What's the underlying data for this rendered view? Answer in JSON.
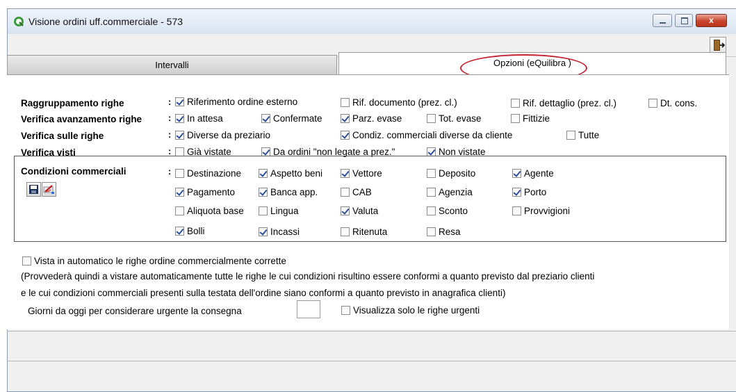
{
  "window": {
    "title": "Visione ordini uff.commerciale - 573",
    "close_label": "x"
  },
  "icons": {
    "app": "app-logo-icon",
    "exit": "exit-door-icon",
    "save": "save-disk-icon",
    "edit": "edit-pencil-icon"
  },
  "tabs": {
    "intervalli": "Intervalli",
    "opzioni": "Opzioni (eQuilibra )"
  },
  "labels": {
    "raggruppamento": "Raggruppamento righe",
    "avanzamento": "Verifica avanzamento righe",
    "sulle_righe": "Verifica sulle righe",
    "visti": "Verifica visti",
    "condizioni": "Condizioni commerciali",
    "colon": ":"
  },
  "raggruppamento": [
    {
      "label": "Riferimento ordine esterno",
      "checked": true
    },
    {
      "label": "Rif. documento (prez. cl.)",
      "checked": false
    },
    {
      "label": "Rif. dettaglio (prez. cl.)",
      "checked": false
    },
    {
      "label": "Dt. cons.",
      "checked": false
    }
  ],
  "avanzamento": [
    {
      "label": "In attesa",
      "checked": true
    },
    {
      "label": "Confermate",
      "checked": true
    },
    {
      "label": "Parz. evase",
      "checked": true
    },
    {
      "label": "Tot. evase",
      "checked": false
    },
    {
      "label": "Fittizie",
      "checked": false
    }
  ],
  "sulle_righe": [
    {
      "label": "Diverse da preziario",
      "checked": true
    },
    {
      "label": "Condiz. commerciali diverse da cliente",
      "checked": true
    },
    {
      "label": "Tutte",
      "checked": false
    }
  ],
  "visti": [
    {
      "label": "Già vistate",
      "checked": false
    },
    {
      "label": "Da ordini \"non legate a prez.\"",
      "checked": true
    },
    {
      "label": "Non vistate",
      "checked": true
    }
  ],
  "condizioni": [
    {
      "label": "Destinazione",
      "checked": false
    },
    {
      "label": "Aspetto beni",
      "checked": true
    },
    {
      "label": "Vettore",
      "checked": true
    },
    {
      "label": "Deposito",
      "checked": false
    },
    {
      "label": "Agente",
      "checked": true
    },
    {
      "label": "Pagamento",
      "checked": true
    },
    {
      "label": "Banca app.",
      "checked": true
    },
    {
      "label": "CAB",
      "checked": false
    },
    {
      "label": "Agenzia",
      "checked": false
    },
    {
      "label": "Porto",
      "checked": true
    },
    {
      "label": "Aliquota base",
      "checked": false
    },
    {
      "label": "Lingua",
      "checked": false
    },
    {
      "label": "Valuta",
      "checked": true
    },
    {
      "label": "Sconto",
      "checked": false
    },
    {
      "label": "Provvigioni",
      "checked": false
    },
    {
      "label": "Bolli",
      "checked": true
    },
    {
      "label": "Incassi",
      "checked": true
    },
    {
      "label": "Ritenuta",
      "checked": false
    },
    {
      "label": "Resa",
      "checked": false
    }
  ],
  "auto": {
    "label": "Vista in automatico le righe ordine commercialmente corrette",
    "checked": false,
    "note1": "(Provvederà quindi a vistare automaticamente tutte le righe le cui condizioni risultino essere conformi a quanto previsto dal preziario clienti",
    "note2": "e le cui condizioni commerciali presenti sulla testata dell'ordine siano conformi a quanto previsto in anagrafica clienti)"
  },
  "urgent": {
    "days_label": "Giorni da oggi per considerare urgente la consegna",
    "days_value": "",
    "only_urgent_label": "Visualizza solo le righe urgenti",
    "only_urgent_checked": false
  }
}
